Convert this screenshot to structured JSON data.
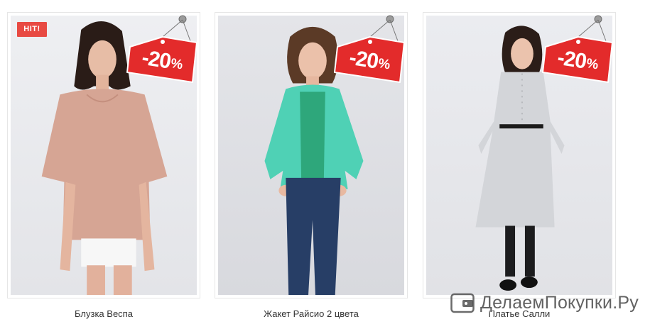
{
  "products": [
    {
      "name": "Блузка Веспа",
      "badge": "HIT!",
      "discount": "-20",
      "discount_unit": "%"
    },
    {
      "name": "Жакет Райсио 2 цвета",
      "discount": "-20",
      "discount_unit": "%"
    },
    {
      "name": "Платье Салли",
      "discount": "-20",
      "discount_unit": "%"
    }
  ],
  "watermark": {
    "text": "ДелаемПокупки.Ру"
  },
  "colors": {
    "badge_red": "#e84a43",
    "tag_red": "#e32b2b",
    "name_text": "#333333"
  }
}
